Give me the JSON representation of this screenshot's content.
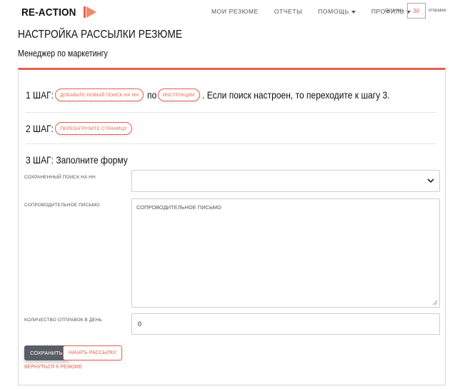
{
  "brand": {
    "name": "RE-ACTION",
    "accent": "#e8604c"
  },
  "nav": {
    "items": [
      {
        "label": "МОИ РЕЗЮМЕ",
        "dropdown": false
      },
      {
        "label": "ОТЧЕТЫ",
        "dropdown": false
      },
      {
        "label": "ПОМОЩЬ",
        "dropdown": true
      },
      {
        "label": "ПРОФИЛЬ",
        "dropdown": true
      }
    ],
    "remaining_prefix": "Осталось",
    "remaining_count": "30",
    "remaining_suffix": "отправок"
  },
  "page": {
    "title": "НАСТРОЙКА РАССЫЛКИ РЕЗЮМЕ",
    "subtitle": "Менеджер по маркетингу"
  },
  "step1": {
    "label": "1 ШАГ:",
    "add_search_chip": "ДОБАВЬТЕ НОВЫЙ ПОИСК НА HH",
    "connector": "по",
    "instructions_chip": "ИНСТРУКЦИИ",
    "text": ". Если поиск настроен, то переходите к шагу 3."
  },
  "step2": {
    "label": "2 ШАГ:",
    "reload_chip": "ПЕРЕЗАГРУЗИТЕ СТРАНИЦУ"
  },
  "step3": {
    "title": "3 ШАГ: Заполните форму"
  },
  "form": {
    "saved_search_label": "СОХРАНЕННЫЙ ПОИСК НА HH",
    "saved_search_value": "",
    "cover_letter_label": "СОПРОВОДИТЕЛЬНОЕ ПИСЬМО",
    "cover_letter_placeholder": "СОПРОВОДИТЕЛЬНОЕ ПИСЬМО",
    "per_day_label": "КОЛИЧЕСТВО ОТПРАВОК В ДЕНЬ",
    "per_day_value": "0"
  },
  "actions": {
    "save_label": "СОХРАНИТЬ",
    "start_label": "НАЧАТЬ РАССЫЛКУ",
    "back_label": "ВЕРНУТЬСЯ К РЕЗЮМЕ"
  }
}
